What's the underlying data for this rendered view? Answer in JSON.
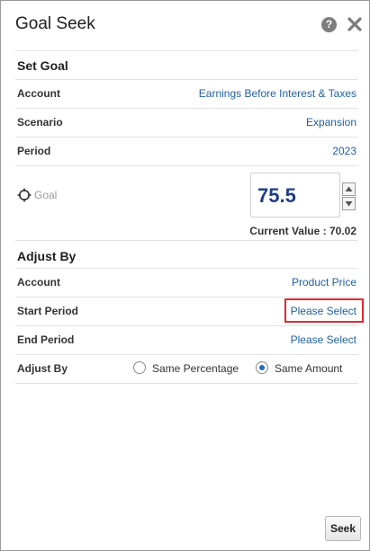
{
  "dialog": {
    "title": "Goal Seek",
    "help_icon_glyph": "?",
    "icons": [
      "help-icon",
      "close-icon"
    ]
  },
  "set_goal": {
    "heading": "Set Goal",
    "account_label": "Account",
    "account_value": "Earnings Before Interest & Taxes",
    "scenario_label": "Scenario",
    "scenario_value": "Expansion",
    "period_label": "Period",
    "period_value": "2023",
    "goal_label": "Goal",
    "goal_value": "75.5",
    "current_value": "Current Value : 70.02"
  },
  "adjust_by": {
    "heading": "Adjust By",
    "account_label": "Account",
    "account_value": "Product Price",
    "start_period_label": "Start Period",
    "start_period_value": "Please Select",
    "end_period_label": "End Period",
    "end_period_value": "Please Select",
    "adjust_label": "Adjust By",
    "options": [
      {
        "label": "Same Percentage",
        "selected": false
      },
      {
        "label": "Same Amount",
        "selected": true
      }
    ]
  },
  "footer": {
    "seek_label": "Seek"
  },
  "colors": {
    "link": "#1f5f9f",
    "goal_value": "#1e3f86",
    "highlight": "#e0292e",
    "radio_selected": "#1f6fbf"
  }
}
